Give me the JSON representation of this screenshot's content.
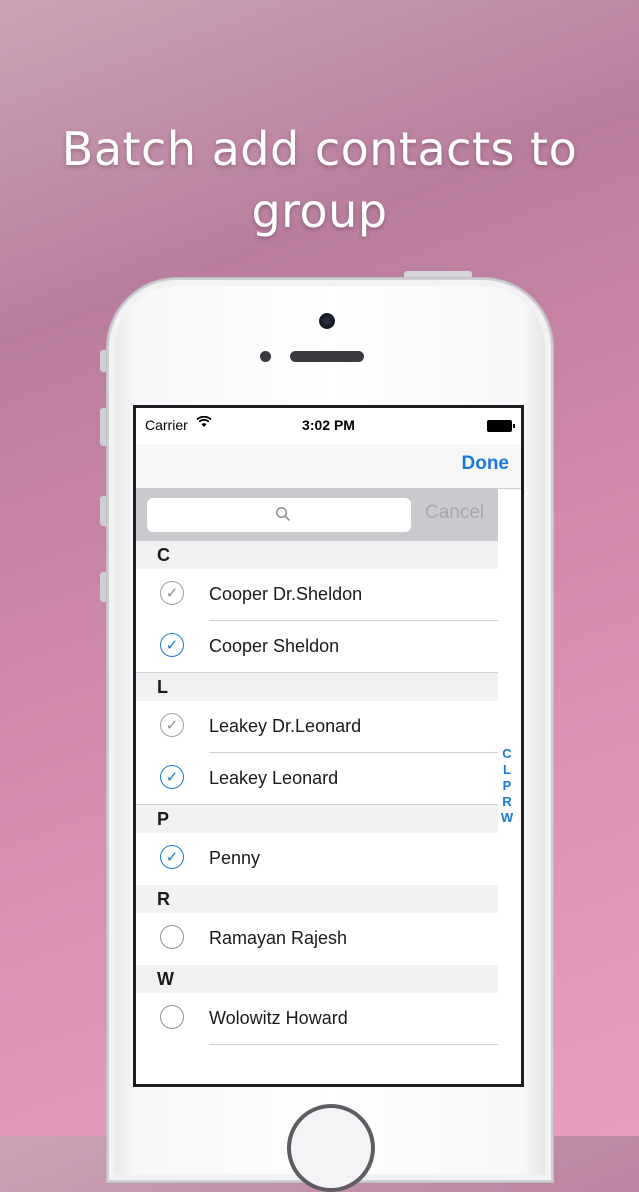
{
  "headline": {
    "line1": "Batch add contacts to",
    "line2": "group"
  },
  "status": {
    "carrier": "Carrier",
    "time": "3:02 PM"
  },
  "nav": {
    "done_label": "Done"
  },
  "search": {
    "placeholder": "",
    "cancel_label": "Cancel"
  },
  "sections": [
    {
      "letter": "C",
      "rows": [
        {
          "name": "Cooper Dr.Sheldon",
          "state": "gray"
        },
        {
          "name": "Cooper Sheldon",
          "state": "checked"
        }
      ]
    },
    {
      "letter": "L",
      "rows": [
        {
          "name": "Leakey Dr.Leonard",
          "state": "gray"
        },
        {
          "name": "Leakey Leonard",
          "state": "checked"
        }
      ]
    },
    {
      "letter": "P",
      "rows": [
        {
          "name": "Penny",
          "state": "checked"
        }
      ]
    },
    {
      "letter": "R",
      "rows": [
        {
          "name": "Ramayan Rajesh",
          "state": "unchecked"
        }
      ]
    },
    {
      "letter": "W",
      "rows": [
        {
          "name": "Wolowitz Howard",
          "state": "unchecked"
        }
      ]
    }
  ],
  "index_letters": [
    "C",
    "L",
    "P",
    "R",
    "W"
  ],
  "colors": {
    "accent": "#1a79d6",
    "section_bg": "#f1f1f3"
  }
}
